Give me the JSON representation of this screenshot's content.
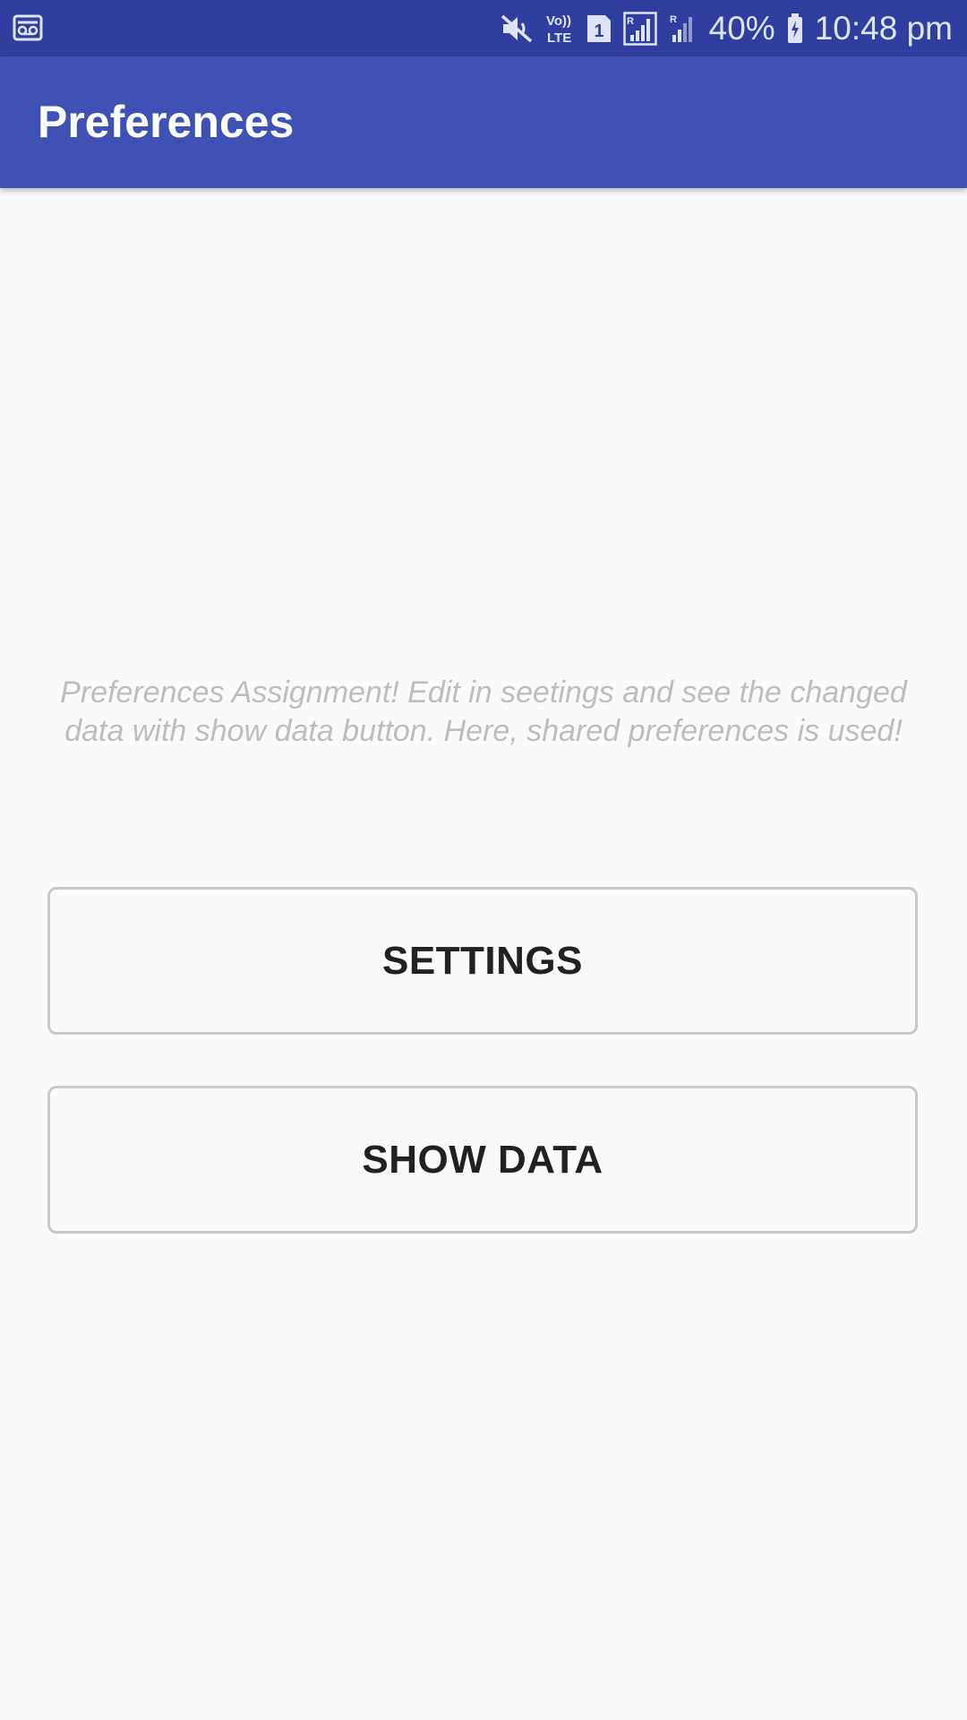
{
  "status_bar": {
    "left_icon": "voicemail-icon",
    "icons": [
      "mute-icon",
      "volte-icon",
      "sim-1-icon",
      "signal-roaming-icon",
      "signal-icon",
      "battery-charging-icon"
    ],
    "volte_label_top": "Vo))",
    "volte_label_bottom": "LTE",
    "sim_number": "1",
    "battery_percent": "40%",
    "time": "10:48 pm"
  },
  "app_bar": {
    "title": "Preferences"
  },
  "main": {
    "description": "Preferences Assignment! Edit in seetings and see the changed data with show data button. Here, shared preferences is used!",
    "buttons": [
      {
        "label": "SETTINGS"
      },
      {
        "label": "SHOW DATA"
      }
    ]
  },
  "colors": {
    "status_bar": "#303f9f",
    "app_bar": "#3f51b5",
    "background": "#fafafa",
    "description_text": "#bdbdbd",
    "button_border": "#c8c8c8",
    "button_text": "#212121"
  }
}
